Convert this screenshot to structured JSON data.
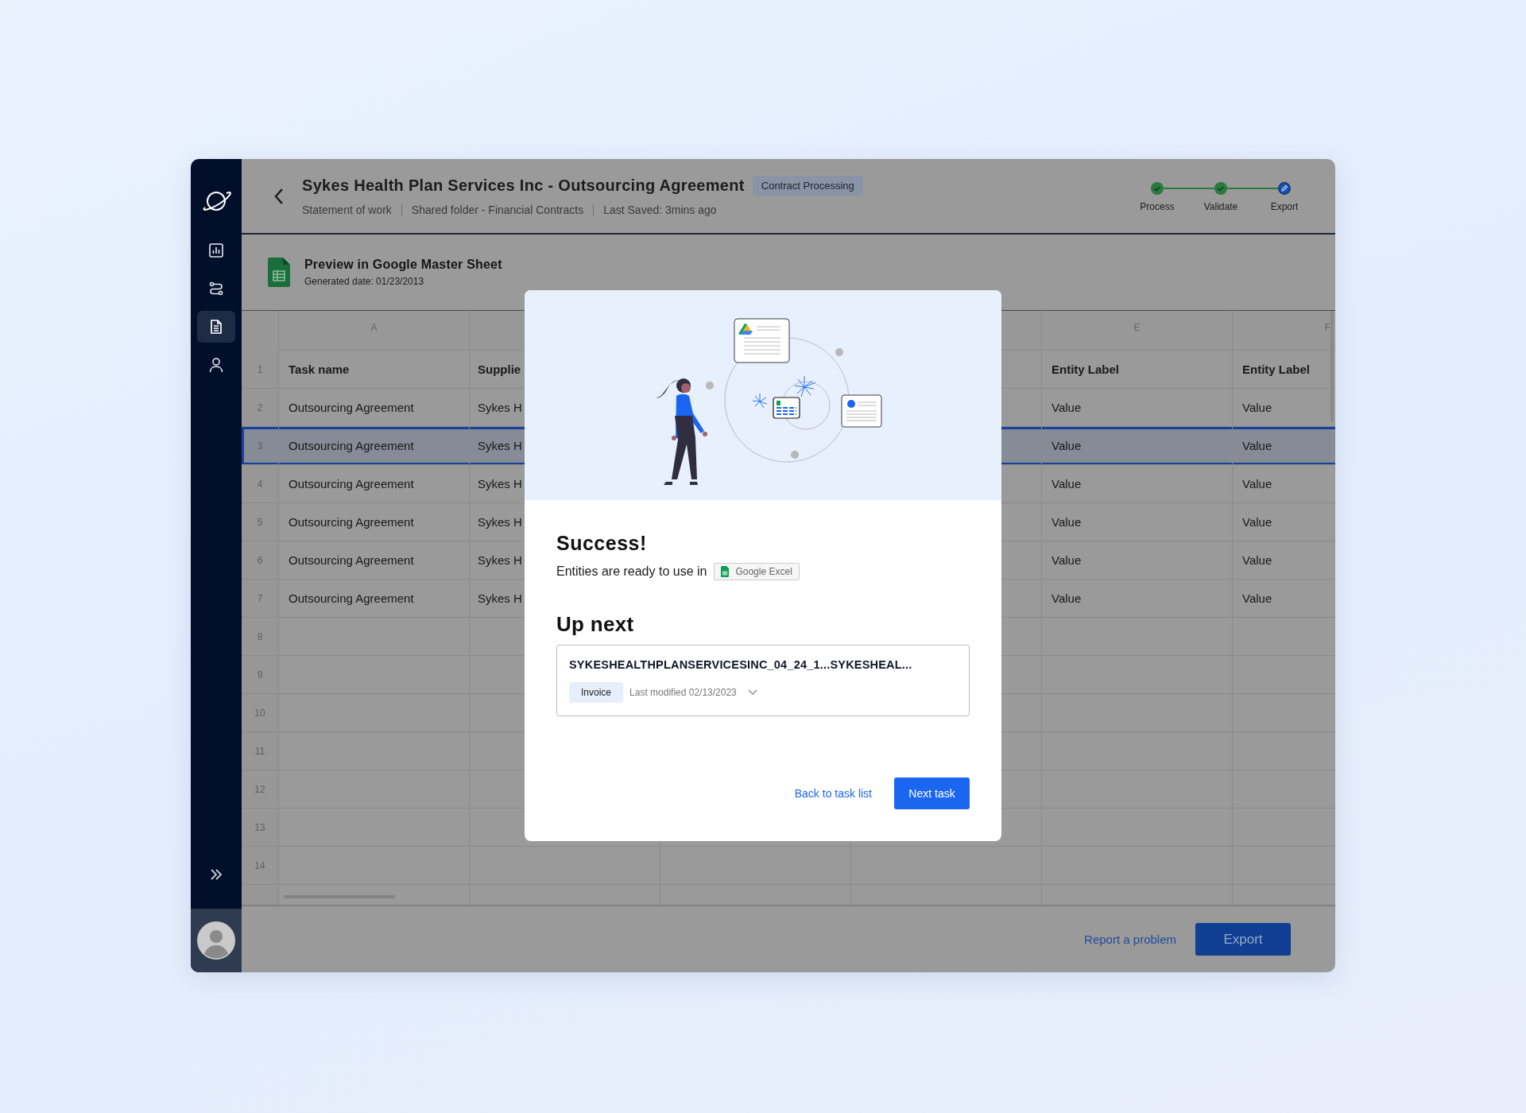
{
  "sidebar": {
    "items": [
      {
        "kind": "chart",
        "selected": false
      },
      {
        "kind": "route",
        "selected": false
      },
      {
        "kind": "document",
        "selected": true
      },
      {
        "kind": "user",
        "selected": false
      }
    ]
  },
  "header": {
    "title": "Sykes Health Plan Services Inc - Outsourcing Agreement",
    "tag": "Contract Processing",
    "meta": [
      "Statement of work",
      "Shared folder - Financial Contracts",
      "Last Saved: 3mins ago"
    ],
    "steps": [
      {
        "label": "Process",
        "completed": true,
        "selected": false
      },
      {
        "label": "Validate",
        "completed": true,
        "selected": false
      },
      {
        "label": "Export",
        "completed": false,
        "selected": true
      }
    ]
  },
  "preview": {
    "title": "Preview in Google Master Sheet",
    "generated": "Generated date: 01/23/2013"
  },
  "table": {
    "columns": [
      "A",
      "E",
      "F"
    ],
    "rows": [
      {
        "number": "1",
        "kind": "header",
        "selected": false,
        "cells": [
          "Task name",
          "Supplie",
          "Entity Label",
          "Entity Label"
        ]
      },
      {
        "number": "2",
        "kind": "data",
        "selected": false,
        "cells": [
          "Outsourcing Agreement",
          "Sykes H",
          "Value",
          "Value"
        ]
      },
      {
        "number": "3",
        "kind": "data",
        "selected": true,
        "cells": [
          "Outsourcing Agreement",
          "Sykes H",
          "Value",
          "Value"
        ]
      },
      {
        "number": "4",
        "kind": "data",
        "selected": false,
        "cells": [
          "Outsourcing Agreement",
          "Sykes H",
          "Value",
          "Value"
        ]
      },
      {
        "number": "5",
        "kind": "data",
        "selected": false,
        "cells": [
          "Outsourcing Agreement",
          "Sykes H",
          "Value",
          "Value"
        ]
      },
      {
        "number": "6",
        "kind": "data",
        "selected": false,
        "cells": [
          "Outsourcing Agreement",
          "Sykes H",
          "Value",
          "Value"
        ]
      },
      {
        "number": "7",
        "kind": "data",
        "selected": false,
        "cells": [
          "Outsourcing Agreement",
          "Sykes H",
          "Value",
          "Value"
        ]
      },
      {
        "number": "8",
        "kind": "data",
        "selected": false
      },
      {
        "number": "9",
        "kind": "data",
        "selected": false
      },
      {
        "number": "10",
        "kind": "data",
        "selected": false
      },
      {
        "number": "11",
        "kind": "data",
        "selected": false
      },
      {
        "number": "12",
        "kind": "data",
        "selected": false
      },
      {
        "number": "13",
        "kind": "data",
        "selected": false
      },
      {
        "number": "14",
        "kind": "data",
        "selected": false
      }
    ]
  },
  "footer": {
    "link": "Report a problem",
    "button": "Export"
  },
  "dialog": {
    "title": "Success!",
    "message": "Entities are ready to use in",
    "app_chip": "Google Excel",
    "up_next_title": "Up next",
    "next_item": {
      "name": "SYKESHEALTHPLANSERVICESINC_04_24_1...SYKESHEAL...",
      "type": "Invoice",
      "modified": "Last modified 02/13/2023"
    },
    "buttons": [
      {
        "label": "Back to task list",
        "kind": "link"
      },
      {
        "label": "Next task",
        "kind": "primary"
      }
    ]
  }
}
